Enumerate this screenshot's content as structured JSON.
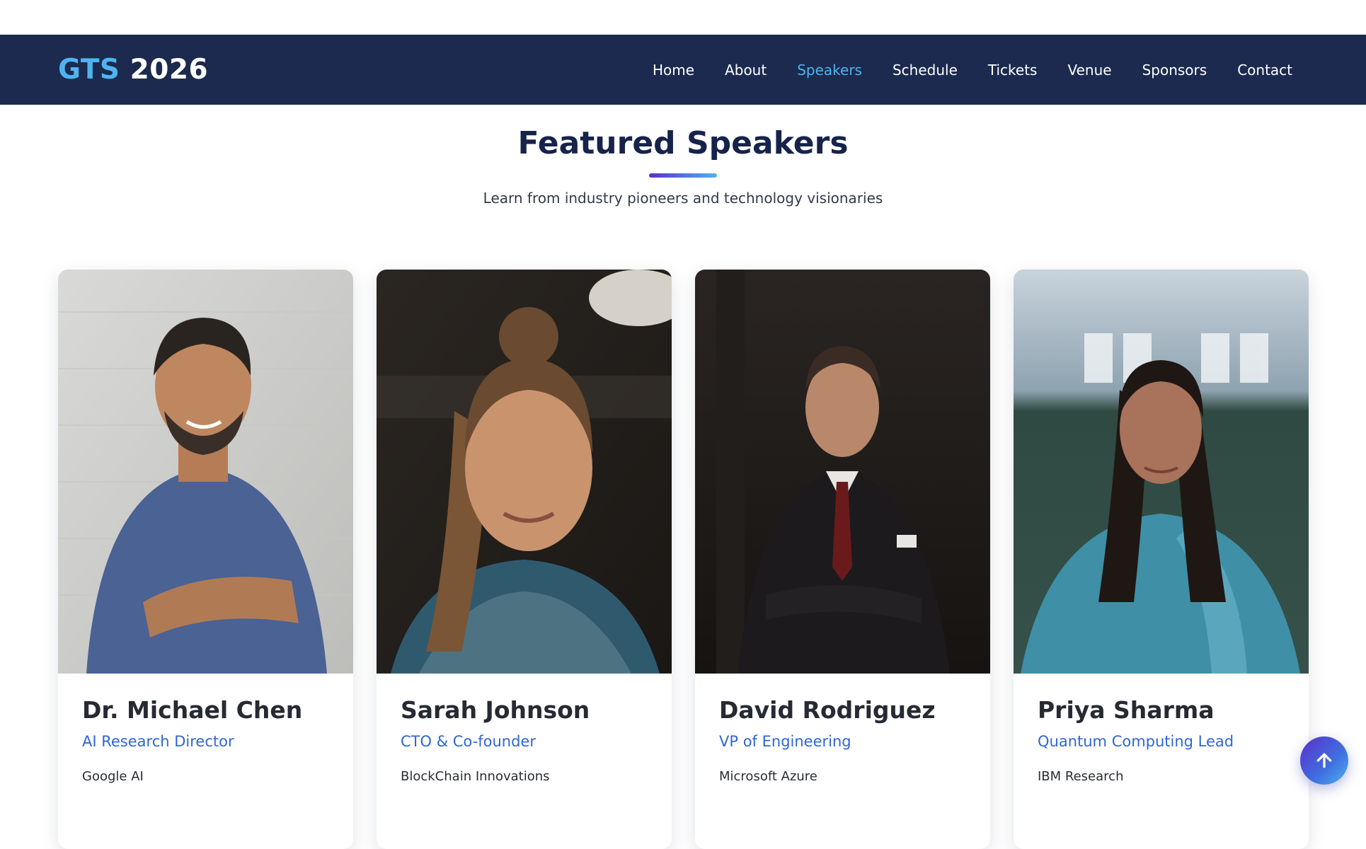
{
  "navbar": {
    "logo_prefix": "GTS",
    "logo_year": "2026",
    "links": [
      {
        "label": "Home",
        "active": false
      },
      {
        "label": "About",
        "active": false
      },
      {
        "label": "Speakers",
        "active": true
      },
      {
        "label": "Schedule",
        "active": false
      },
      {
        "label": "Tickets",
        "active": false
      },
      {
        "label": "Venue",
        "active": false
      },
      {
        "label": "Sponsors",
        "active": false
      },
      {
        "label": "Contact",
        "active": false
      }
    ]
  },
  "section": {
    "title": "Featured Speakers",
    "subtitle": "Learn from industry pioneers and technology visionaries"
  },
  "speakers": [
    {
      "name": "Dr. Michael Chen",
      "role": "AI Research Director",
      "company": "Google AI"
    },
    {
      "name": "Sarah Johnson",
      "role": "CTO & Co-founder",
      "company": "BlockChain Innovations"
    },
    {
      "name": "David Rodriguez",
      "role": "VP of Engineering",
      "company": "Microsoft Azure"
    },
    {
      "name": "Priya Sharma",
      "role": "Quantum Computing Lead",
      "company": "IBM Research"
    }
  ],
  "icons": {
    "scroll_top": "arrow-up-icon"
  },
  "colors": {
    "navbar_bg": "#1b2a4e",
    "accent": "#4fb3f0",
    "role_text": "#2f66d6",
    "title_text": "#16234a"
  }
}
